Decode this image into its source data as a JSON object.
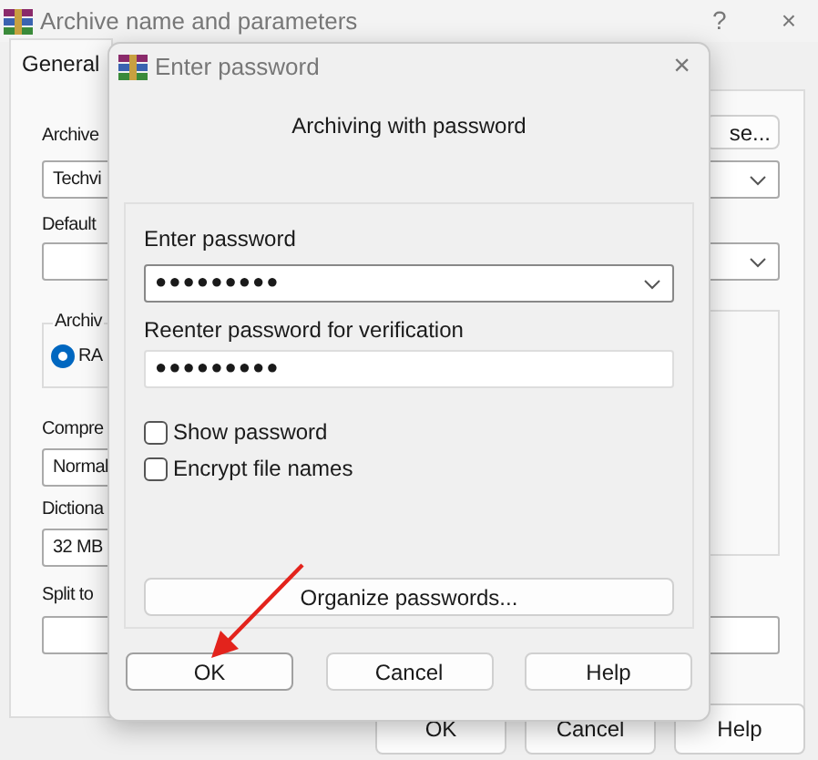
{
  "main_window": {
    "title": "Archive name and parameters",
    "help": "?",
    "close": "×",
    "tabs": [
      {
        "label": "General",
        "selected": true
      }
    ],
    "archive_label": "Archive",
    "archive_name": "Techvi",
    "browse_button": "se...",
    "default_label": "Default",
    "format_group": "Archiv",
    "format_options": [
      {
        "label": "RA",
        "selected": true
      }
    ],
    "compression_label": "Compre",
    "compression_value": "Normal",
    "dictionary_label": "Dictiona",
    "dictionary_value": "32 MB",
    "split_label": "Split to",
    "buttons": [
      "OK",
      "Cancel",
      "Help"
    ]
  },
  "password_dialog": {
    "title": "Enter password",
    "close": "×",
    "heading": "Archiving with password",
    "password_label": "Enter password",
    "password_value": "●●●●●●●●●",
    "reenter_label": "Reenter password for verification",
    "reenter_value": "●●●●●●●●●",
    "options": [
      {
        "label": "Show password",
        "checked": false
      },
      {
        "label": "Encrypt file names",
        "checked": false
      }
    ],
    "organize_button": "Organize passwords...",
    "buttons": [
      {
        "label": "OK",
        "selected": true
      },
      {
        "label": "Cancel",
        "selected": false
      },
      {
        "label": "Help",
        "selected": false
      }
    ]
  }
}
